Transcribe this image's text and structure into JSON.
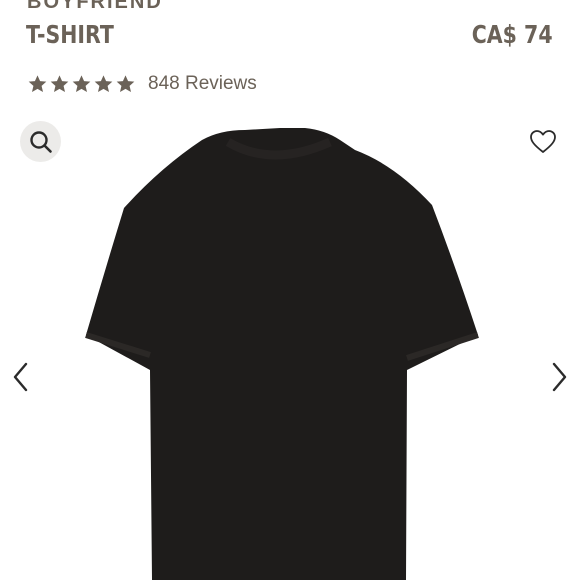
{
  "product": {
    "collection_label": "BOYFRIEND",
    "name": "T-SHIRT",
    "price": "CA$ 74",
    "rating_value": 5,
    "rating_max": 5,
    "reviews_label": "848 Reviews",
    "color": "#1e1c1b"
  },
  "gallery": {
    "zoom_icon": "search-icon",
    "wishlist_icon": "heart-outline-icon",
    "prev_icon": "chevron-left-icon",
    "next_icon": "chevron-right-icon"
  },
  "colors": {
    "text": "#6b6258",
    "zoom_bg": "#ecebe9",
    "star": "#6b6258"
  }
}
